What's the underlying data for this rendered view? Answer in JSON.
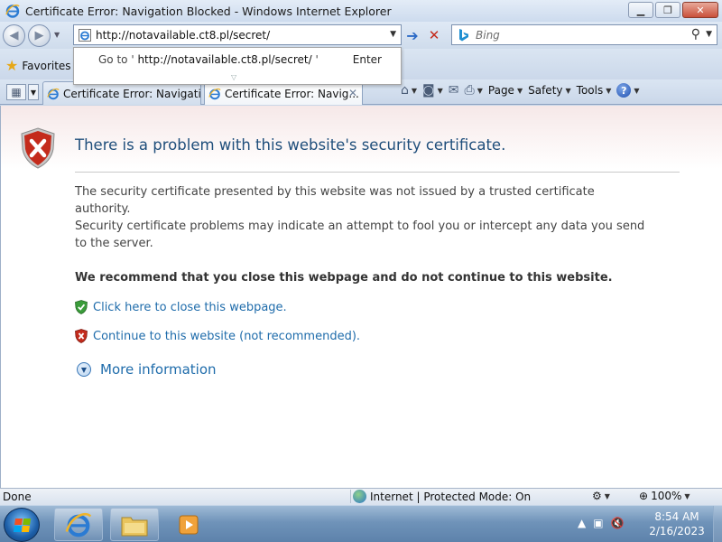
{
  "window": {
    "title": "Certificate Error: Navigation Blocked - Windows Internet Explorer",
    "minimize_icon": "minimize-icon",
    "maximize_icon": "maximize-icon",
    "close_icon": "close-icon"
  },
  "address_bar": {
    "url": "http://notavailable.ct8.pl/secret/",
    "search_placeholder": "Bing"
  },
  "autocomplete": {
    "goto_prefix": "Go to '",
    "goto_url": "http://notavailable.ct8.pl/secret/",
    "goto_suffix": "'",
    "enter_label": "Enter"
  },
  "favorites": {
    "label": "Favorites"
  },
  "tabs": [
    {
      "label": "Certificate Error: Navigatio..."
    },
    {
      "label": "Certificate Error: Navig..."
    }
  ],
  "command_bar": {
    "page": "Page",
    "safety": "Safety",
    "tools": "Tools"
  },
  "content": {
    "heading": "There is a problem with this website's security certificate.",
    "para1": "The security certificate presented by this website was not issued by a trusted certificate authority.",
    "para2": "Security certificate problems may indicate an attempt to fool you or intercept any data you send to the server.",
    "recommend": "We recommend that you close this webpage and do not continue to this website.",
    "close_link": "Click here to close this webpage.",
    "continue_link": "Continue to this website (not recommended).",
    "more_info": "More information"
  },
  "status": {
    "left": "Done",
    "zone": "Internet | Protected Mode: On",
    "zoom": "100%"
  },
  "taskbar": {
    "time": "8:54 AM",
    "date": "2/16/2023"
  },
  "colors": {
    "heading": "#1f4e7b",
    "link": "#1f6cab",
    "error_red": "#c42b1c",
    "safe_green": "#3a9c3a"
  }
}
